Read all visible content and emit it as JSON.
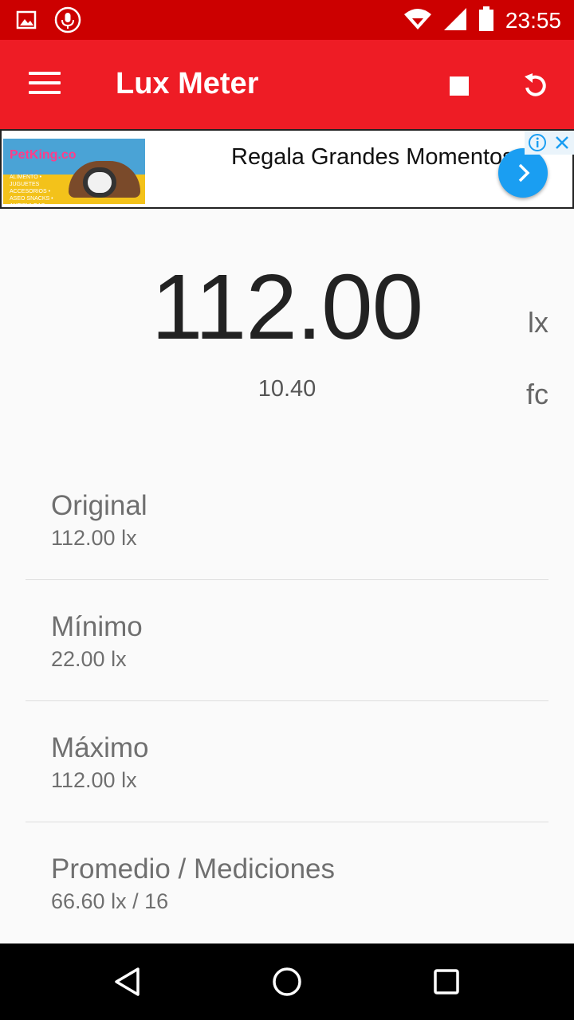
{
  "status_bar": {
    "time": "23:55",
    "icons": [
      "image-icon",
      "microphone-icon",
      "wifi-icon",
      "signal-icon",
      "battery-icon"
    ]
  },
  "app_bar": {
    "title": "Lux Meter",
    "menu_icon": "menu-icon",
    "stop_icon": "stop-icon",
    "reset_icon": "refresh-icon",
    "color": "#ee1c25"
  },
  "ad": {
    "image_brand": "PetKing.co",
    "image_tagline": "ALIMENTO • JUGUETES ACCESORIOS • ASEO SNACKS • ANTIPULGAS ARENAS • CAMAS",
    "text": "Regala Grandes Momentos",
    "arrow_icon": "chevron-right-icon",
    "info_icon": "info-icon",
    "close_icon": "close-icon"
  },
  "reading": {
    "value": "112.00",
    "unit": "lx",
    "secondary_value": "10.40",
    "secondary_unit": "fc"
  },
  "stats": [
    {
      "label": "Original",
      "value": "112.00 lx"
    },
    {
      "label": "Mínimo",
      "value": "22.00 lx"
    },
    {
      "label": "Máximo",
      "value": "112.00 lx"
    },
    {
      "label": "Promedio / Mediciones",
      "value": "66.60 lx / 16"
    }
  ],
  "nav_bar": {
    "icons": [
      "back-icon",
      "home-icon",
      "recents-icon"
    ]
  }
}
